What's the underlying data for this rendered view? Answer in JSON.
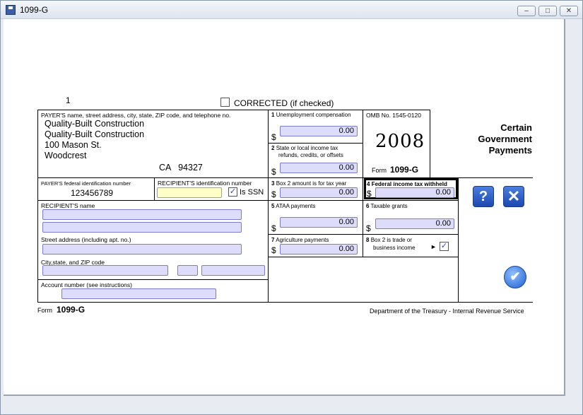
{
  "window": {
    "title": "1099-G",
    "minimize_label": "–",
    "maximize_label": "□",
    "close_label": "✕"
  },
  "form": {
    "page_number": "1",
    "corrected_label": "CORRECTED  (if checked)",
    "corrected_checked": false,
    "payer": {
      "label": "PAYER'S name, street address, city, state, ZIP code, and telephone no.",
      "line1": "Quality-Built Construction",
      "line2": "Quality-Built Construction",
      "line3": "100 Mason St.",
      "line4": "Woodcrest",
      "state_zip": "CA   94327"
    },
    "payer_id": {
      "label": "PAYER'S federal identification number",
      "value": "123456789"
    },
    "recipient_id": {
      "label": "RECIPIENT'S identification number",
      "value": "",
      "is_ssn_label": "Is SSN",
      "is_ssn_checked": true
    },
    "recipient_name": {
      "label": "RECIPIENT'S name"
    },
    "street": {
      "label": "Street address (including apt. no.)"
    },
    "city": {
      "label": "City,state, and ZIP code"
    },
    "account": {
      "label": "Account number (see instructions)"
    },
    "boxes": {
      "box1": {
        "num": "1",
        "label": "Unemployment compensation",
        "value": "0.00"
      },
      "box2": {
        "num": "2",
        "label_a": "State or local income tax",
        "label_b": "refunds, credits, or offsets",
        "value": "0.00"
      },
      "box3": {
        "num": "3",
        "label": "Box 2 amount is for tax year",
        "value": "0.00"
      },
      "box4": {
        "num": "4",
        "label": "Federal income tax withheld",
        "value": "0.00"
      },
      "box5": {
        "num": "5",
        "label": "ATAA payments",
        "value": "0.00"
      },
      "box6": {
        "num": "6",
        "label": "Taxable grants",
        "value": "0.00"
      },
      "box7": {
        "num": "7",
        "label": "Agriculture payments",
        "value": "0.00"
      },
      "box8": {
        "num": "8",
        "label_a": "Box 2 is trade or",
        "label_b": "business income",
        "arrow": "►",
        "checked": true
      }
    },
    "dollar_sign": "$",
    "omb": "OMB No. 1545-0120",
    "year": "2008",
    "form_word": "Form",
    "form_name": "1099-G",
    "heading": {
      "line1": "Certain",
      "line2": "Government",
      "line3": "Payments"
    },
    "footer_form_word": "Form",
    "footer_form_name": "1099-G",
    "footer_dept": "Department of the Treasury - Internal Revenue Service",
    "help_label": "?",
    "close_label": "✕",
    "ok_label": "✔",
    "check_mark": "✓"
  }
}
